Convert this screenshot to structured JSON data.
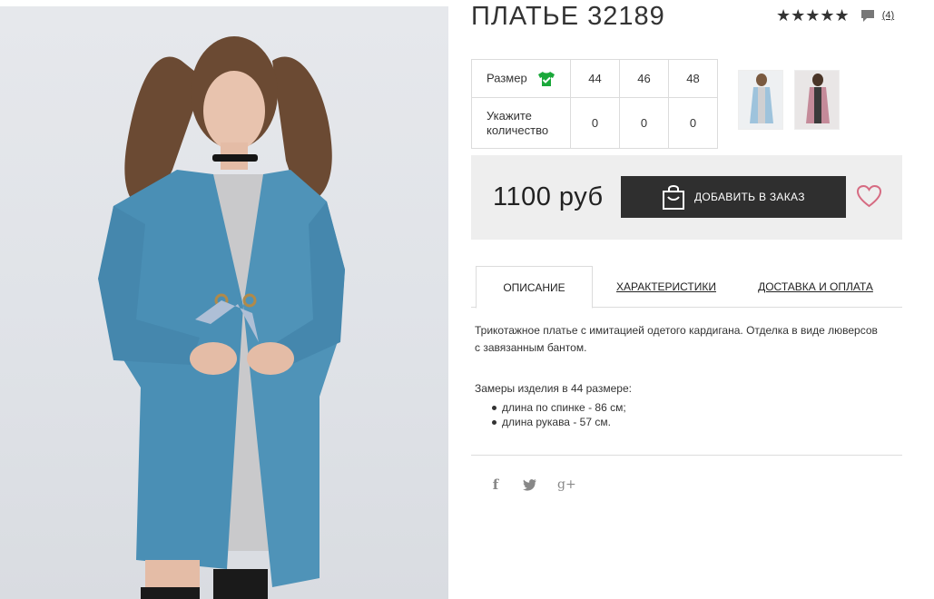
{
  "product": {
    "title": "ПЛАТЬЕ 32189",
    "stars": "★★★★★",
    "review_count": "(4)"
  },
  "sizes": {
    "size_label": "Размер",
    "quantity_label_1": "Укажите",
    "quantity_label_2": "количество",
    "values": [
      "44",
      "46",
      "48"
    ],
    "quantities": [
      "0",
      "0",
      "0"
    ]
  },
  "price": {
    "amount": "1100 руб",
    "order_button": "ДОБАВИТЬ В ЗАКАЗ"
  },
  "tabs": [
    {
      "label": "ОПИСАНИЕ"
    },
    {
      "label": "ХАРАКТЕРИСТИКИ"
    },
    {
      "label": "ДОСТАВКА И ОПЛАТА"
    }
  ],
  "description": {
    "text": "Трикотажное платье с имитацией одетого кардигана. Отделка в виде люверсов с завязанным бантом.",
    "measure_title": "Замеры изделия в 44 размере:",
    "measures": [
      "длина по спинке - 86 см;",
      "длина рукава - 57 см."
    ]
  },
  "social": {
    "facebook": "f",
    "twitter": "🐦",
    "google": "g+"
  },
  "colors": {
    "accent_green": "#1aa83a",
    "button_dark": "#2f2f2f",
    "heart_pink": "#d66b82",
    "cardigan_blue": "#4a8fb5"
  }
}
